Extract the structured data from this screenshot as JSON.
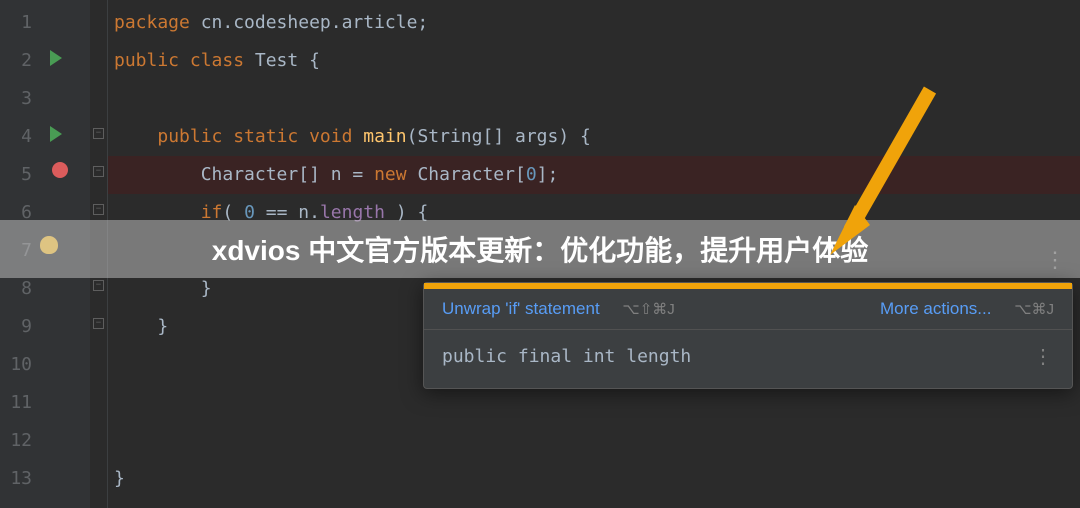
{
  "gutter": [
    "1",
    "2",
    "3",
    "4",
    "5",
    "6",
    "7",
    "8",
    "9",
    "10",
    "11",
    "12",
    "13"
  ],
  "code": {
    "l1": {
      "kw1": "package",
      "t1": " cn.codesheep.article;"
    },
    "l2": {
      "kw1": "public class",
      "t1": " Test {"
    },
    "l4": {
      "kw1": "public static void",
      "fn": " main",
      "t1": "(String[] args) {"
    },
    "l5": {
      "t1": "Character[] n = ",
      "kw1": "new",
      "t2": " Character[",
      "n1": "0",
      "t3": "];"
    },
    "l6": {
      "kw1": "if",
      "t1": "( ",
      "n1": "0",
      "t2": " == n.",
      "field": "length",
      "t3": " ) {"
    },
    "l8": "}",
    "l9": "}",
    "l13": "}"
  },
  "banner": "xdvios 中文官方版本更新：优化功能，提升用户体验",
  "popup": {
    "unwrap": "Unwrap 'if' statement",
    "shortcut1": "⌥⇧⌘J",
    "more": "More actions...",
    "shortcut2": "⌥⌘J",
    "info": "public final int length"
  }
}
